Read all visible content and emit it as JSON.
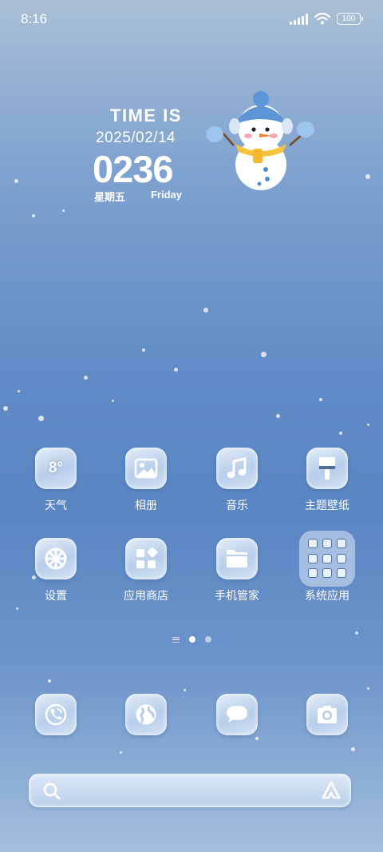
{
  "status_bar": {
    "time": "8:16",
    "battery": "100"
  },
  "clock_widget": {
    "heading": "TIME IS",
    "date": "2025/02/14",
    "time": "0236",
    "weekday_cn": "星期五",
    "weekday_en": "Friday"
  },
  "apps": [
    {
      "label": "天气",
      "icon": "weather-icon",
      "icon_text": "8°"
    },
    {
      "label": "相册",
      "icon": "gallery-icon"
    },
    {
      "label": "音乐",
      "icon": "music-icon"
    },
    {
      "label": "主题壁纸",
      "icon": "theme-brush-icon"
    },
    {
      "label": "设置",
      "icon": "settings-icon"
    },
    {
      "label": "应用商店",
      "icon": "app-store-icon"
    },
    {
      "label": "手机管家",
      "icon": "phone-manager-folder-icon"
    },
    {
      "label": "系统应用",
      "icon": "system-apps-folder"
    }
  ],
  "dock": [
    {
      "icon": "phone-icon"
    },
    {
      "icon": "browser-globe-icon"
    },
    {
      "icon": "messages-icon"
    },
    {
      "icon": "camera-icon"
    }
  ],
  "page_indicator": {
    "pages": 2,
    "active": 1
  },
  "search_bar": {
    "icon": "search-icon",
    "assistant_icon": "assistant-icon"
  },
  "colors": {
    "icon_glyph": "#4b6f9c",
    "tile": "#c8daf0",
    "text": "#ffffff"
  }
}
